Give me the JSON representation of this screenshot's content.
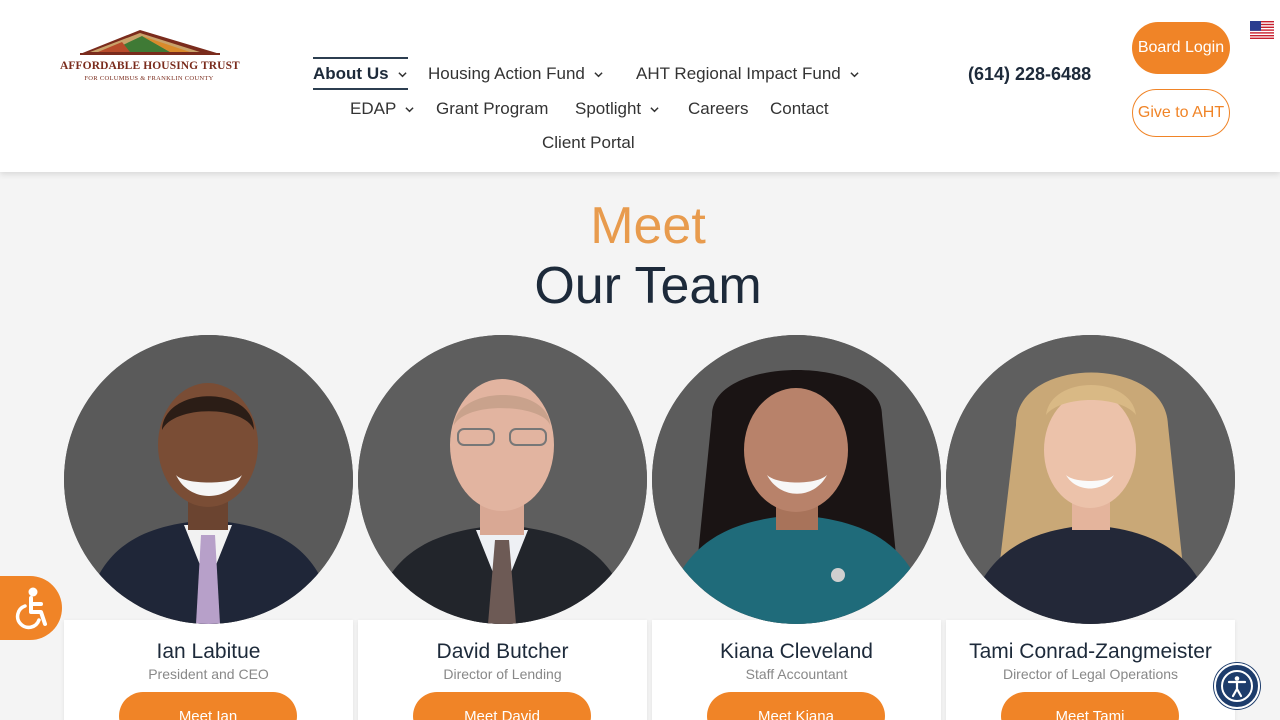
{
  "logo": {
    "title": "AFFORDABLE HOUSING TRUST",
    "subtitle": "FOR COLUMBUS & FRANKLIN COUNTY"
  },
  "nav": {
    "about": "About Us",
    "housing_action_fund": "Housing Action Fund",
    "regional_impact": "AHT Regional Impact Fund",
    "edap": "EDAP",
    "grant_program": "Grant Program",
    "spotlight": "Spotlight",
    "careers": "Careers",
    "contact": "Contact",
    "client_portal": "Client Portal"
  },
  "phone": "(614) 228-6488",
  "buttons": {
    "board_login": "Board Login",
    "give": "Give to AHT"
  },
  "heading": {
    "line1": "Meet",
    "line2": "Our Team"
  },
  "team": [
    {
      "name": "Ian Labitue",
      "role": "President and CEO",
      "button": "Meet Ian"
    },
    {
      "name": "David Butcher",
      "role": "Director of Lending",
      "button": "Meet David"
    },
    {
      "name": "Kiana Cleveland",
      "role": "Staff Accountant",
      "button": "Meet Kiana"
    },
    {
      "name": "Tami Conrad-Zangmeister",
      "role": "Director of Legal Operations",
      "button": "Meet Tami"
    }
  ],
  "icons": {
    "accessibility_left": "wheelchair-icon",
    "accessibility_right": "accessibility-person-icon",
    "language": "us-flag-icon",
    "dropdown": "chevron-down-icon"
  },
  "colors": {
    "accent": "#f08427",
    "heading_light": "#e89b4d",
    "navy": "#1d2a3a",
    "accessibility_blue": "#1d3c6b"
  }
}
